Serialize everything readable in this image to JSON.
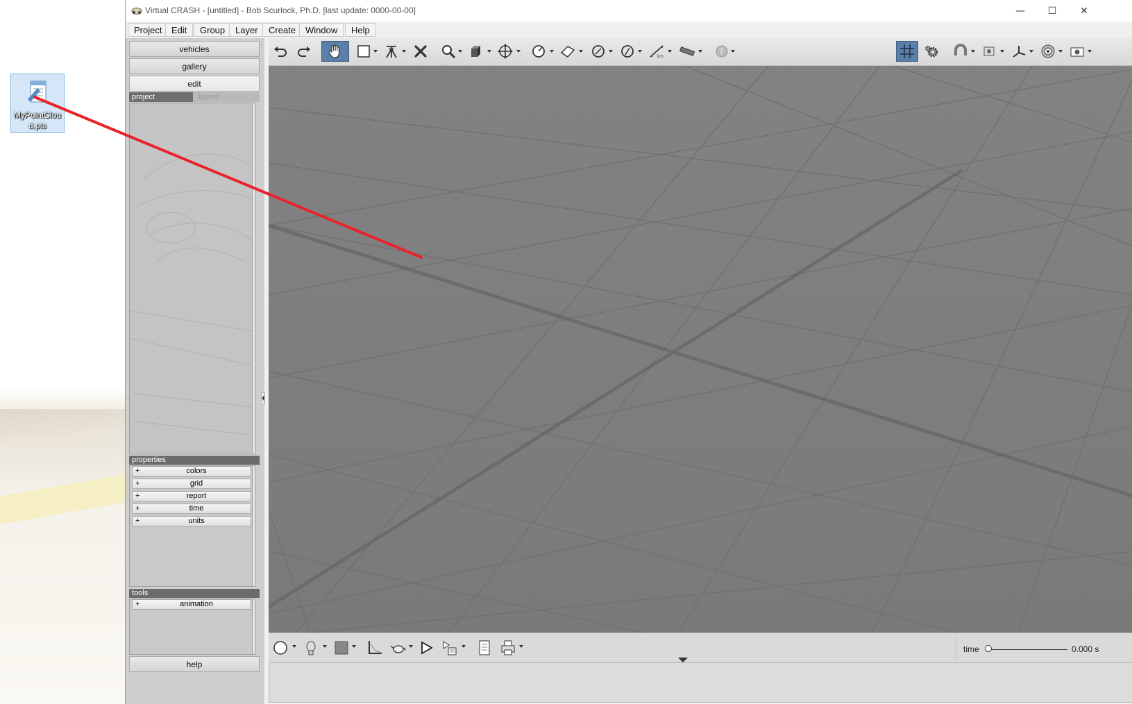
{
  "desktop": {
    "icon_label": "MyPointCloud.pts"
  },
  "window": {
    "title": "Virtual CRASH - [untitled] - Bob Scurlock, Ph.D. [last update: 0000-00-00]",
    "controls": {
      "minimize": "—",
      "maximize": "☐",
      "close": "✕"
    }
  },
  "menu": {
    "items": [
      "Project",
      "Edit",
      "Group",
      "Layer",
      "Create",
      "Window",
      "Help"
    ]
  },
  "left_panel": {
    "buttons": {
      "vehicles": "vehicles",
      "gallery": "gallery",
      "edit": "edit",
      "help": "help"
    },
    "tabs": {
      "project": "project",
      "layers": "layers"
    },
    "properties": {
      "header": "properties",
      "items": [
        "colors",
        "grid",
        "report",
        "time",
        "units"
      ]
    },
    "tools": {
      "header": "tools",
      "items": [
        "animation"
      ]
    },
    "expand_symbol": "+"
  },
  "bottom": {
    "time_label": "time",
    "time_value": "0.000 s",
    "time_fraction": 0
  },
  "colors": {
    "viewport_bg": "#7d7d7d",
    "active_tool": "#5a7fa8",
    "annotation_line": "#e8232a"
  }
}
